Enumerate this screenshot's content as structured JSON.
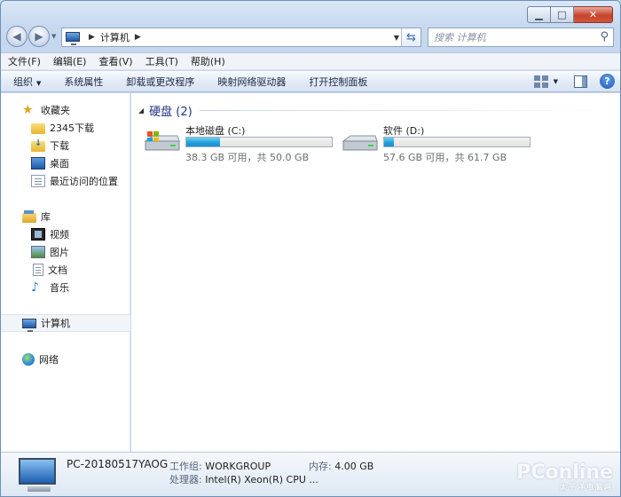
{
  "address": {
    "location": "计算机"
  },
  "search": {
    "placeholder": "搜索 计算机"
  },
  "menu": [
    "文件(F)",
    "编辑(E)",
    "查看(V)",
    "工具(T)",
    "帮助(H)"
  ],
  "commands": {
    "organize": "组织",
    "system_properties": "系统属性",
    "uninstall": "卸载或更改程序",
    "map_drive": "映射网络驱动器",
    "control_panel": "打开控制面板"
  },
  "sidebar": {
    "favorites": "收藏夹",
    "fav_items": [
      "2345下载",
      "下载",
      "桌面",
      "最近访问的位置"
    ],
    "libraries": "库",
    "lib_items": [
      "视频",
      "图片",
      "文档",
      "音乐"
    ],
    "computer": "计算机",
    "network": "网络"
  },
  "group": {
    "title": "硬盘 (2)"
  },
  "drives": [
    {
      "name": "本地磁盘 (C:)",
      "free_text": "38.3 GB 可用，共 50.0 GB",
      "used_fraction": 0.234
    },
    {
      "name": "软件 (D:)",
      "free_text": "57.6 GB 可用，共 61.7 GB",
      "used_fraction": 0.066
    }
  ],
  "details": {
    "pc_name": "PC-20180517YAOG",
    "workgroup_label": "工作组:",
    "workgroup": "WORKGROUP",
    "memory_label": "内存:",
    "memory": "4.00 GB",
    "cpu_label": "处理器:",
    "cpu": "Intel(R) Xeon(R) CPU ..."
  },
  "watermark": {
    "brand": "PConline",
    "sub": "太平洋电脑网"
  },
  "colors": {
    "accent": "#26a0da",
    "group_title": "#1e3287"
  }
}
